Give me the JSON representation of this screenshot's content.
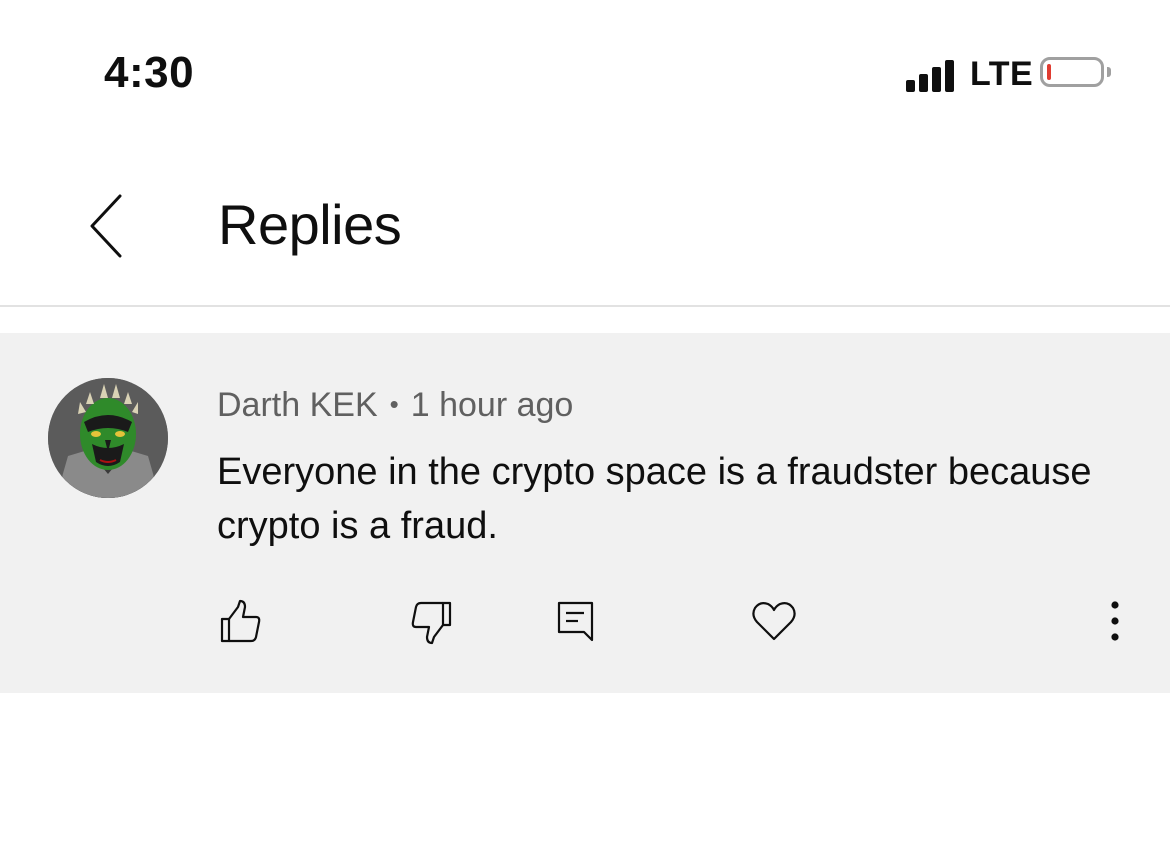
{
  "status_bar": {
    "time": "4:30",
    "network": "LTE",
    "battery_level": 0.08,
    "battery_color": "#e03c31"
  },
  "header": {
    "title": "Replies",
    "back_icon": "chevron-left-icon"
  },
  "comment": {
    "author": "Darth KEK",
    "separator": "•",
    "time": "1 hour ago",
    "text": "Everyone in the crypto space is a fraudster because crypto is a fraud.",
    "background_color": "#f1f1f1",
    "actions": {
      "like_icon": "thumbs-up-icon",
      "dislike_icon": "thumbs-down-icon",
      "reply_icon": "comment-icon",
      "heart_icon": "heart-icon",
      "more_icon": "more-vertical-icon"
    }
  }
}
